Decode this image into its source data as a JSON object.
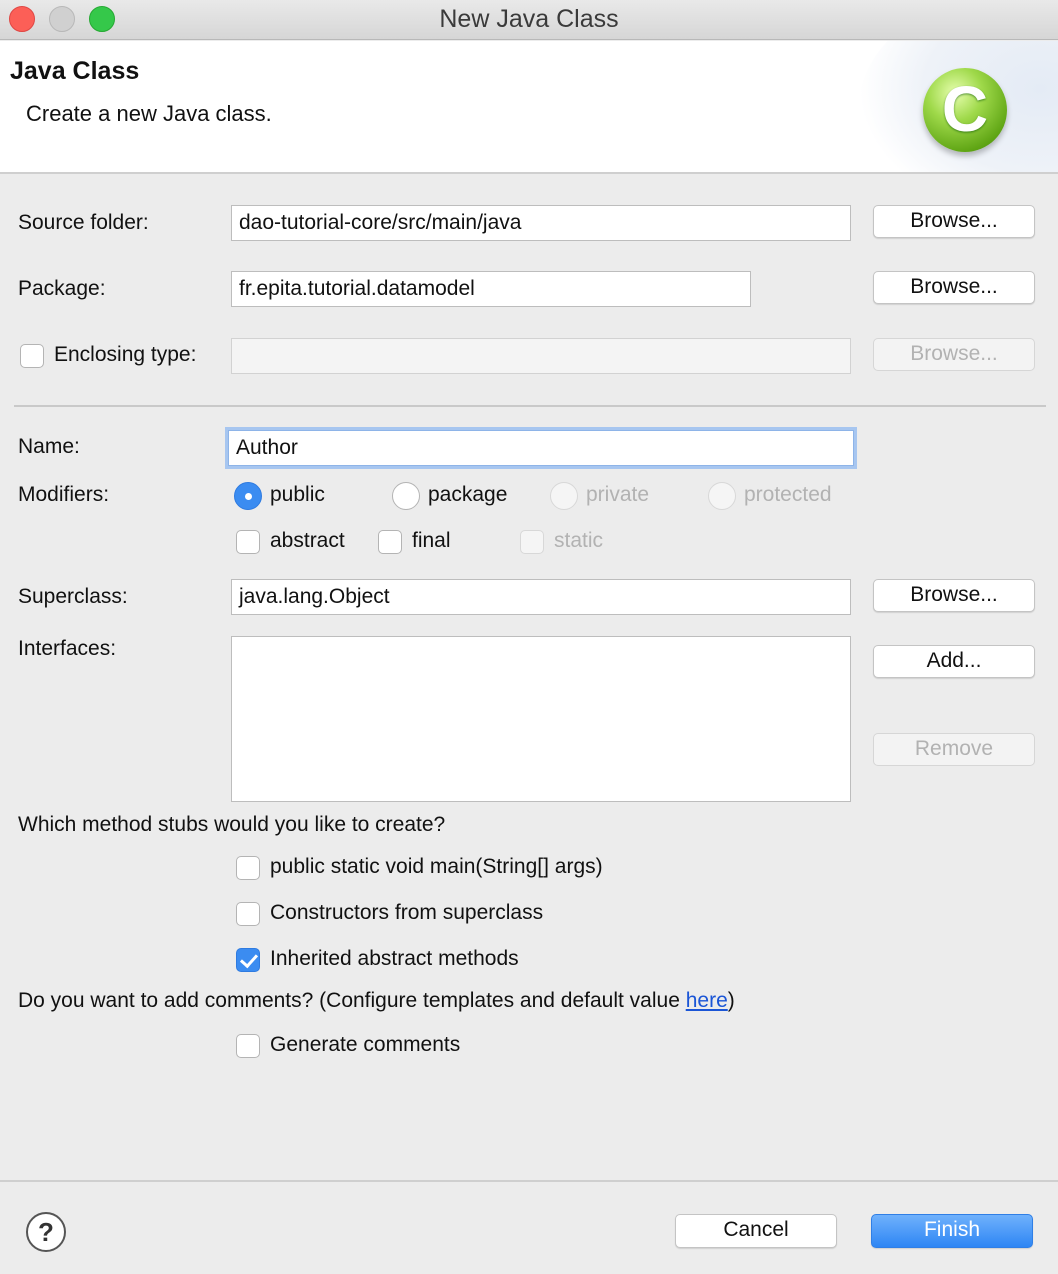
{
  "window": {
    "title": "New Java Class"
  },
  "header": {
    "title": "Java Class",
    "description": "Create a new Java class.",
    "icon_letter": "C"
  },
  "form": {
    "source_folder": {
      "label": "Source folder:",
      "value": "dao-tutorial-core/src/main/java",
      "browse": "Browse..."
    },
    "package": {
      "label": "Package:",
      "value": "fr.epita.tutorial.datamodel",
      "browse": "Browse..."
    },
    "enclosing_type": {
      "label": "Enclosing type:",
      "value": "",
      "checked": false,
      "browse": "Browse..."
    },
    "name": {
      "label": "Name:",
      "value": "Author"
    },
    "modifiers": {
      "label": "Modifiers:",
      "access": [
        {
          "label": "public",
          "selected": true,
          "enabled": true
        },
        {
          "label": "package",
          "selected": false,
          "enabled": true
        },
        {
          "label": "private",
          "selected": false,
          "enabled": false
        },
        {
          "label": "protected",
          "selected": false,
          "enabled": false
        }
      ],
      "flags": [
        {
          "label": "abstract",
          "checked": false,
          "enabled": true
        },
        {
          "label": "final",
          "checked": false,
          "enabled": true
        },
        {
          "label": "static",
          "checked": false,
          "enabled": false
        }
      ]
    },
    "superclass": {
      "label": "Superclass:",
      "value": "java.lang.Object",
      "browse": "Browse..."
    },
    "interfaces": {
      "label": "Interfaces:",
      "add": "Add...",
      "remove": "Remove"
    },
    "stubs": {
      "question": "Which method stubs would you like to create?",
      "options": [
        {
          "label": "public static void main(String[] args)",
          "checked": false
        },
        {
          "label": "Constructors from superclass",
          "checked": false
        },
        {
          "label": "Inherited abstract methods",
          "checked": true
        }
      ]
    },
    "comments": {
      "question_prefix": "Do you want to add comments? (Configure templates and default value ",
      "link": "here",
      "question_suffix": ")",
      "option": {
        "label": "Generate comments",
        "checked": false
      }
    }
  },
  "footer": {
    "help": "?",
    "cancel": "Cancel",
    "finish": "Finish"
  },
  "colors": {
    "accent": "#3b8cf1",
    "link": "#1a55d6",
    "icon_green": "#5fa514"
  }
}
